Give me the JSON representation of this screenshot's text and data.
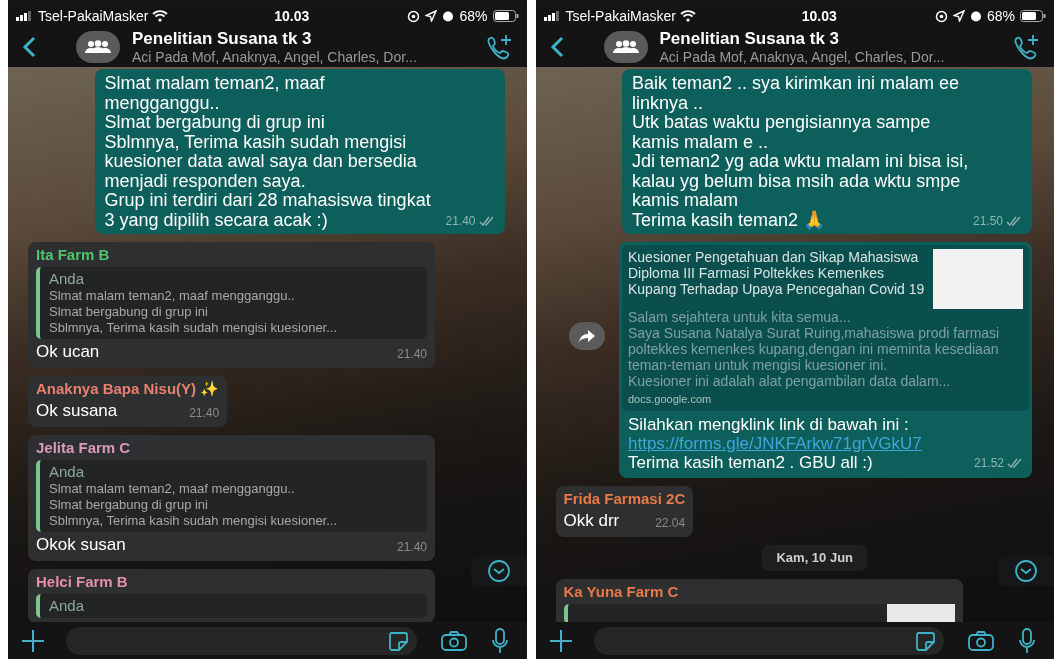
{
  "screens": [
    {
      "status_bar": {
        "carrier": "Tsel-PakaiMasker",
        "time": "10.03",
        "battery": "68%"
      },
      "header": {
        "title": "Penelitian Susana tk 3",
        "subtitle": "Aci Pada Mof, Anaknya, Angel, Charles, Dor..."
      },
      "messages": [
        {
          "kind": "outgoing",
          "text": "Slmat malam teman2, maaf mengganggu..\nSlmat bergabung di grup ini\nSblmnya, Terima kasih sudah mengisi kuesioner data awal saya dan bersedia menjadi responden saya.\nGrup ini terdiri dari 28 mahasiswa tingkat 3 yang dipilih secara acak :)",
          "time": "21.40"
        },
        {
          "kind": "reply",
          "sender": "Ita  Farm B",
          "color": "#4fc46e",
          "quote_author": "Anda",
          "quote_text": "Slmat malam teman2, maaf mengganggu..\nSlmat bergabung di grup ini\nSblmnya, Terima kasih sudah mengisi kuesioner...",
          "text": "Ok ucan",
          "time": "21.40"
        },
        {
          "kind": "incoming",
          "sender": "Anaknya Bapa Nisu(Y) ✨",
          "color": "#e9806f",
          "text": "Ok susana",
          "time": "21.40"
        },
        {
          "kind": "reply",
          "sender": "Jelita Farm C",
          "color": "#d99ab8",
          "quote_author": "Anda",
          "quote_text": "Slmat malam teman2, maaf mengganggu..\nSlmat bergabung di grup ini\nSblmnya, Terima kasih sudah mengisi kuesioner...",
          "text": "Okok susan",
          "time": "21.40"
        },
        {
          "kind": "partial",
          "sender": "Helci Farm B",
          "color": "#e48fab",
          "quote_author": "Anda"
        }
      ]
    },
    {
      "status_bar": {
        "carrier": "Tsel-PakaiMasker",
        "time": "10.03",
        "battery": "68%"
      },
      "header": {
        "title": "Penelitian Susana tk 3",
        "subtitle": "Aci Pada Mof, Anaknya, Angel, Charles, Dor..."
      },
      "messages": [
        {
          "kind": "outgoing",
          "text": "Baik teman2 .. sya kirimkan ini malam ee linknya ..\nUtk batas waktu pengisiannya sampe kamis malam e  ..\nJdi teman2 yg ada wktu malam ini bisa isi, kalau yg belum bisa msih ada wktu smpe kamis malam\nTerima kasih teman2 🙏",
          "time": "21.50"
        },
        {
          "kind": "link",
          "preview_title": "Kuesioner Pengetahuan dan Sikap Mahasiswa Diploma III Farmasi Poltekkes Kemenkes Kupang Terhadap Upaya Pencegahan Covid 19",
          "preview_description": "Salam sejahtera untuk kita semua...\nSaya Susana Natalya Surat Ruing,mahasiswa prodi farmasi poltekkes kemenkes kupang,dengan ini meminta kesediaan teman-teman untuk mengisi kuesioner ini.\nKuesioner ini adalah alat pengambilan data dalam...",
          "preview_domain": "docs.google.com",
          "text": "Silahkan mengklink link di bawah ini :",
          "link": "https://forms.gle/JNKFArkw71grVGkU7",
          "text_after": "Terima kasih teman2 . GBU all :)",
          "time": "21.52"
        },
        {
          "kind": "incoming",
          "sender": "Frida Farmasi 2C",
          "color": "#e8794a",
          "text": "Okk drr",
          "time": "22.04"
        },
        {
          "kind": "date",
          "text": "Kam, 10 Jun"
        },
        {
          "kind": "partial",
          "sender": "Ka Yuna Farm C",
          "color": "#e8794a"
        }
      ]
    }
  ]
}
